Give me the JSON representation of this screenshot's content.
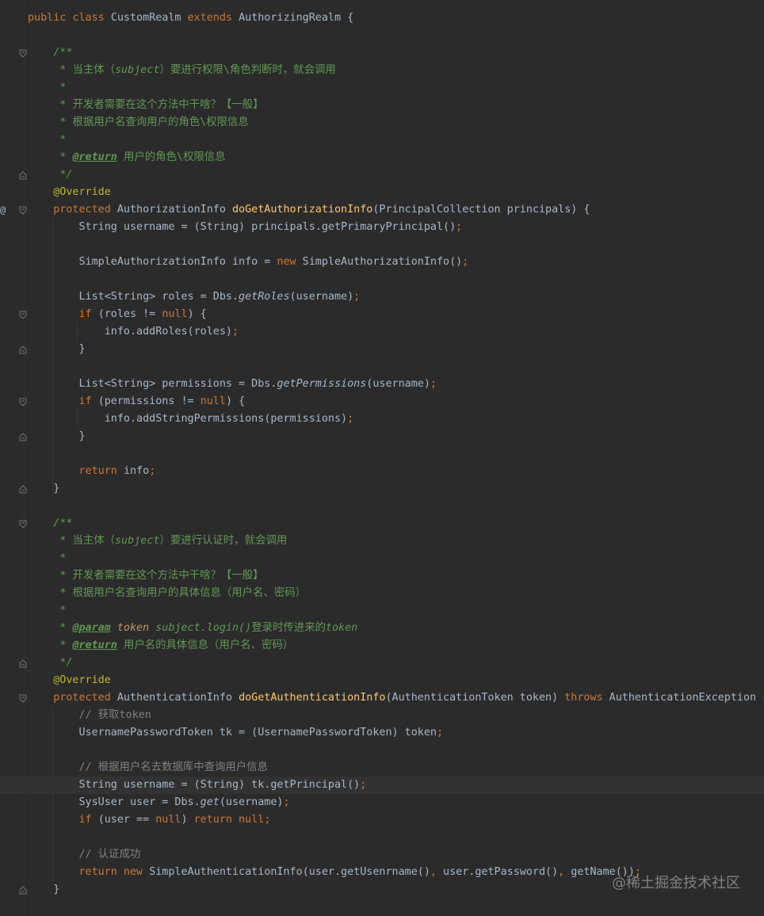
{
  "editor": {
    "watermark": "@稀土掘金技术社区",
    "gutter_marker": "@",
    "lines": [
      [
        [
          "public class ",
          "kw"
        ],
        [
          "CustomRealm ",
          ""
        ],
        [
          "extends ",
          "kw"
        ],
        [
          "AuthorizingRealm {",
          ""
        ]
      ],
      [],
      [
        [
          "    /**",
          "com"
        ]
      ],
      [
        [
          "     * ",
          "com"
        ],
        [
          "当主体（",
          "comtxt"
        ],
        [
          "subject",
          "com"
        ],
        [
          "）要进行权限\\角色判断时，就会调用",
          "comtxt"
        ]
      ],
      [
        [
          "     *",
          "com"
        ]
      ],
      [
        [
          "     * ",
          "com"
        ],
        [
          "开发者需要在这个方法中干啥？【一般】",
          "comtxt"
        ]
      ],
      [
        [
          "     * ",
          "com"
        ],
        [
          "根据用户名查询用户的角色\\权限信息",
          "comtxt"
        ]
      ],
      [
        [
          "     *",
          "com"
        ]
      ],
      [
        [
          "     * ",
          "com"
        ],
        [
          "@return",
          "tag"
        ],
        [
          " 用户的角色\\权限信息",
          "comtxt"
        ]
      ],
      [
        [
          "     */",
          "com"
        ]
      ],
      [
        [
          "    @Override",
          "ann"
        ]
      ],
      [
        [
          "    protected ",
          "kw"
        ],
        [
          "AuthorizationInfo ",
          ""
        ],
        [
          "doGetAuthorizationInfo",
          "fn"
        ],
        [
          "(PrincipalCollection principals) {",
          ""
        ]
      ],
      [
        [
          "        String username = (String) principals.getPrimaryPrincipal()",
          ""
        ],
        [
          ";",
          "sem"
        ]
      ],
      [],
      [
        [
          "        SimpleAuthorizationInfo info = ",
          ""
        ],
        [
          "new ",
          "kw"
        ],
        [
          "SimpleAuthorizationInfo()",
          ""
        ],
        [
          ";",
          "sem"
        ]
      ],
      [],
      [
        [
          "        List<String> roles = Dbs.",
          ""
        ],
        [
          "getRoles",
          "ital"
        ],
        [
          "(username)",
          ""
        ],
        [
          ";",
          "sem"
        ]
      ],
      [
        [
          "        if ",
          "kw"
        ],
        [
          "(roles != ",
          ""
        ],
        [
          "null",
          "kw"
        ],
        [
          ") {",
          ""
        ]
      ],
      [
        [
          "            info.addRoles(roles)",
          ""
        ],
        [
          ";",
          "sem"
        ]
      ],
      [
        [
          "        }",
          ""
        ]
      ],
      [],
      [
        [
          "        List<String> permissions = Dbs.",
          ""
        ],
        [
          "getPermissions",
          "ital"
        ],
        [
          "(username)",
          ""
        ],
        [
          ";",
          "sem"
        ]
      ],
      [
        [
          "        if ",
          "kw"
        ],
        [
          "(permissions != ",
          ""
        ],
        [
          "null",
          "kw"
        ],
        [
          ") {",
          ""
        ]
      ],
      [
        [
          "            info.addStringPermissions(permissions)",
          ""
        ],
        [
          ";",
          "sem"
        ]
      ],
      [
        [
          "        }",
          ""
        ]
      ],
      [],
      [
        [
          "        return ",
          "kw"
        ],
        [
          "info",
          ""
        ],
        [
          ";",
          "sem"
        ]
      ],
      [
        [
          "    }",
          ""
        ]
      ],
      [],
      [
        [
          "    /**",
          "com"
        ]
      ],
      [
        [
          "     * ",
          "com"
        ],
        [
          "当主体（",
          "comtxt"
        ],
        [
          "subject",
          "com"
        ],
        [
          "）要进行认证时，就会调用",
          "comtxt"
        ]
      ],
      [
        [
          "     *",
          "com"
        ]
      ],
      [
        [
          "     * ",
          "com"
        ],
        [
          "开发者需要在这个方法中干啥？【一般】",
          "comtxt"
        ]
      ],
      [
        [
          "     * ",
          "com"
        ],
        [
          "根据用户名查询用户的具体信息（用户名、密码）",
          "comtxt"
        ]
      ],
      [
        [
          "     *",
          "com"
        ]
      ],
      [
        [
          "     * ",
          "com"
        ],
        [
          "@param",
          "tag"
        ],
        [
          " token",
          "ptoken"
        ],
        [
          " subject.login()",
          "com"
        ],
        [
          "登录时传进来的",
          "comtxt"
        ],
        [
          "token",
          "com"
        ]
      ],
      [
        [
          "     * ",
          "com"
        ],
        [
          "@return",
          "tag"
        ],
        [
          " 用户名的具体信息（用户名、密码）",
          "comtxt"
        ]
      ],
      [
        [
          "     */",
          "com"
        ]
      ],
      [
        [
          "    @Override",
          "ann"
        ]
      ],
      [
        [
          "    protected ",
          "kw"
        ],
        [
          "AuthenticationInfo ",
          ""
        ],
        [
          "doGetAuthenticationInfo",
          "fn"
        ],
        [
          "(AuthenticationToken token) ",
          ""
        ],
        [
          "throws ",
          "kw"
        ],
        [
          "AuthenticationException {",
          ""
        ]
      ],
      [
        [
          "        // 获取token",
          "lc"
        ]
      ],
      [
        [
          "        UsernamePasswordToken tk = (UsernamePasswordToken) token",
          ""
        ],
        [
          ";",
          "sem"
        ]
      ],
      [],
      [
        [
          "        // 根据用户名去数据库中查询用户信息",
          "lc"
        ]
      ],
      [
        [
          "        String username = (String) tk.getPrincipal()",
          ""
        ],
        [
          ";",
          "sem"
        ]
      ],
      [
        [
          "        SysUser user = Dbs.",
          ""
        ],
        [
          "get",
          "ital"
        ],
        [
          "(username)",
          ""
        ],
        [
          ";",
          "sem"
        ]
      ],
      [
        [
          "        if ",
          "kw"
        ],
        [
          "(user == ",
          ""
        ],
        [
          "null",
          "kw"
        ],
        [
          ") ",
          ""
        ],
        [
          "return null",
          "kw"
        ],
        [
          ";",
          "sem"
        ]
      ],
      [],
      [
        [
          "        // 认证成功",
          "lc"
        ]
      ],
      [
        [
          "        return new ",
          "kw"
        ],
        [
          "SimpleAuthenticationInfo(user.getUsenrname()",
          ""
        ],
        [
          ", ",
          "sem"
        ],
        [
          "user.getPassword()",
          ""
        ],
        [
          ", ",
          "sem"
        ],
        [
          "getName())",
          ""
        ],
        [
          ";",
          "sem"
        ]
      ],
      [
        [
          "    }",
          ""
        ]
      ]
    ]
  }
}
